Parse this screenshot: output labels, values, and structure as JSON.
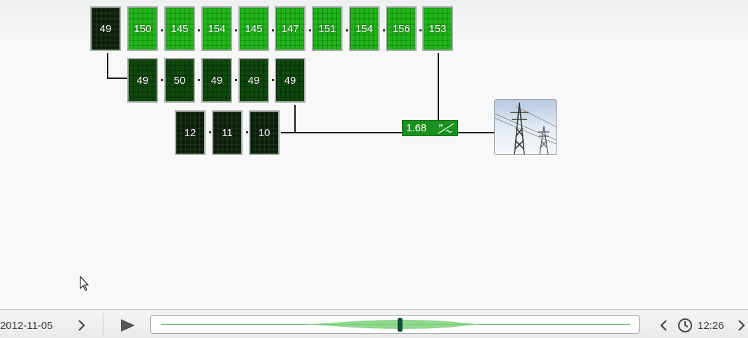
{
  "string_1": {
    "panels": [
      "49",
      "150",
      "145",
      "154",
      "145",
      "147",
      "151",
      "154",
      "156",
      "153"
    ]
  },
  "string_2": {
    "panels": [
      "49",
      "50",
      "49",
      "49",
      "49"
    ]
  },
  "string_3": {
    "panels": [
      "12",
      "11",
      "10"
    ]
  },
  "inverter": {
    "value": "1.68",
    "icon": "inverter-dc-ac-icon",
    "color": "#19911c"
  },
  "grid": {
    "icon": "power-pylon-icon"
  },
  "colors": {
    "panel_high": "#21b51b",
    "panel_mid": "#0f4a0c",
    "panel_low": "#0c1e0a",
    "wire": "#1a1a1a"
  },
  "playback": {
    "date": "2012-11-05",
    "time": "12:26",
    "date_next_icon": "chevron-right-icon",
    "play_icon": "play-icon",
    "prev_icon": "chevron-left-icon",
    "clock_icon": "clock-icon",
    "next_icon": "chevron-right-icon",
    "timeline_position": 0.51
  }
}
